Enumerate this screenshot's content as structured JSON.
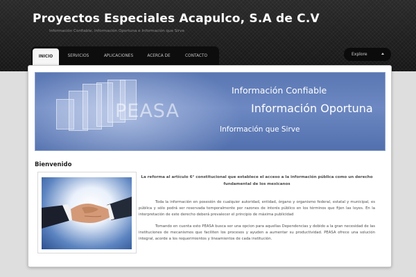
{
  "header": {
    "title": "Proyectos Especiales Acapulco, S.A de C.V",
    "tagline": "Información Confiable, Información Oportuna e Información que Sirve"
  },
  "nav": {
    "items": [
      {
        "label": "INICIO",
        "active": true
      },
      {
        "label": "SERVICIOS",
        "active": false
      },
      {
        "label": "APLICACIONES",
        "active": false
      },
      {
        "label": "ACERCA DE",
        "active": false
      },
      {
        "label": "CONTACTO",
        "active": false
      }
    ]
  },
  "explore": {
    "label": "Explore",
    "icon": "caret-up-icon"
  },
  "banner": {
    "logo_text": "PEASA",
    "line1": "Información Confiable",
    "line2": "Información Oportuna",
    "line3": "Información que Sirve"
  },
  "main": {
    "heading": "Bienvenido",
    "intro": "La reforma al artículo 6° constitucional que establece el acceso a la información pública como un derecho fundamental de los mexicanos",
    "paragraph1": "Toda la información en posesión de cualquier autoridad, entidad, órgano y organismo federal, estatal y municipal, es pública y sólo podrá ser reservada temporalmente por razones de interés público en los términos que fijen las leyes. En la interpretación de este derecho deberá prevalecer el principio de máxima publicidad",
    "paragraph2": "Tomando en cuenta esto PEASA busca ser una opcion para aquellas Dependencias y debido a la gran necesidad de las instituciones de mecanismos que faciliten los procesos y ayuden a aumentar su productividad. PEASA ofrece una solución integral, acorde a los requerimientos y lineamientos de cada institución."
  },
  "colors": {
    "header_bg": "#1b1b1b",
    "banner_blue": "#5a77b3",
    "page_bg": "#dedede"
  }
}
